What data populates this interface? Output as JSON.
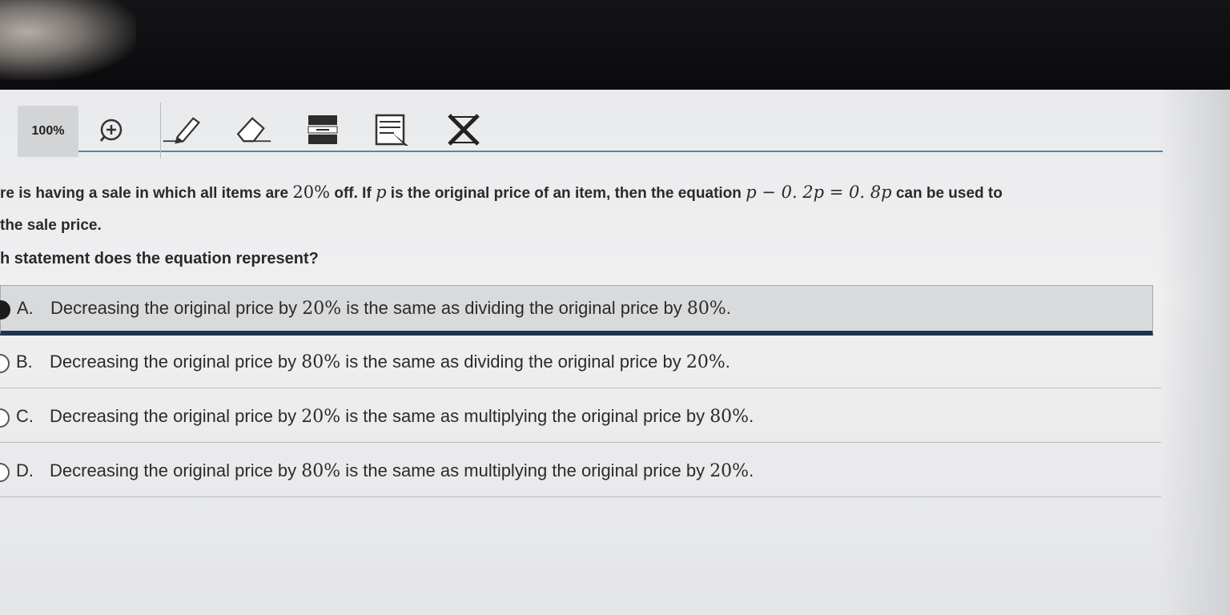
{
  "toolbar": {
    "zoom_label": "100%",
    "icons": [
      "zoom-in-icon",
      "pencil-highlighter-icon",
      "eraser-icon",
      "line-reader-icon",
      "notepad-icon",
      "answer-eliminator-icon"
    ]
  },
  "question": {
    "part1": "re is having a sale in which all items are ",
    "pct_off": "20%",
    "part2": " off. If ",
    "var_p": "p",
    "part3": " is the original price of an item, then the equation ",
    "equation": "p − 0. 2p = 0. 8p",
    "part4": " can be used to",
    "line2": "the sale price.",
    "prompt": "h statement does the equation represent?"
  },
  "options": [
    {
      "letter": "A.",
      "pre": "Decreasing the original price by ",
      "n1": "20%",
      "mid": " is the same as dividing the original price by ",
      "n2": "80%",
      "post": ".",
      "selected": true
    },
    {
      "letter": "B.",
      "pre": "Decreasing the original price by ",
      "n1": "80%",
      "mid": " is the same as dividing the original price by ",
      "n2": "20%",
      "post": ".",
      "selected": false
    },
    {
      "letter": "C.",
      "pre": "Decreasing the original price by ",
      "n1": "20%",
      "mid": " is the same as multiplying the original price by ",
      "n2": "80%",
      "post": ".",
      "selected": false
    },
    {
      "letter": "D.",
      "pre": "Decreasing the original price by ",
      "n1": "80%",
      "mid": " is the same as multiplying the original price by ",
      "n2": "20%",
      "post": ".",
      "selected": false
    }
  ],
  "colors": {
    "selected_underline": "#1e3552",
    "toolbar_rule": "#4d8ba6"
  }
}
